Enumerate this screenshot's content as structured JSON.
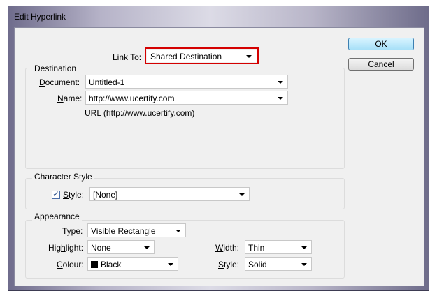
{
  "window": {
    "title": "Edit Hyperlink"
  },
  "link_to": {
    "label": "Link To:",
    "value": "Shared Destination"
  },
  "buttons": {
    "ok": "OK",
    "cancel": "Cancel"
  },
  "destination": {
    "title": "Destination",
    "document_label": "Document:",
    "document_value": "Untitled-1",
    "name_label": "Name:",
    "name_value": "http://www.ucertify.com",
    "url_text": "URL (http://www.ucertify.com)"
  },
  "character_style": {
    "title": "Character Style",
    "style_label": "Style:",
    "style_checked": true,
    "style_value": "[None]"
  },
  "appearance": {
    "title": "Appearance",
    "type_label": "Type:",
    "type_value": "Visible Rectangle",
    "highlight_label": "Highlight:",
    "highlight_value": "None",
    "width_label": "Width:",
    "width_value": "Thin",
    "colour_label": "Colour:",
    "colour_value": "Black",
    "colour_swatch": "#000000",
    "style_label": "Style:",
    "style_value": "Solid"
  },
  "colors": {
    "highlight_box": "#d40000",
    "default_button": "#a7e0f8"
  }
}
